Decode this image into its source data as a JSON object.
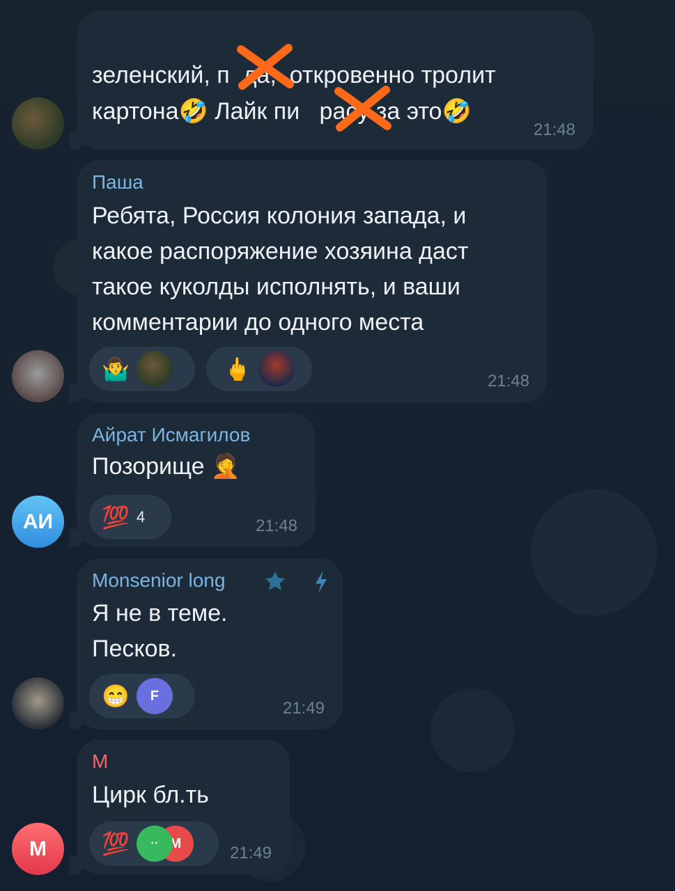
{
  "messages": [
    {
      "text_line1": "зеленский, п  да,  откровенно тролит",
      "text_line2": "картона🤣 Лайк пи   расу за это🤣",
      "time": "21:48"
    },
    {
      "sender": "Паша",
      "text": "Ребята, Россия колония запада, и\nкакое распоряжение хозяина даст\nтакое куколды исполнять, и ваши\nкомментарии до одного места",
      "reactions": [
        {
          "emoji": "🤷‍♂️"
        },
        {
          "emoji": "🖕"
        }
      ],
      "time": "21:48"
    },
    {
      "sender": "Айрат Исмагилов",
      "text": "Позорище 🤦",
      "avatar_initials": "АИ",
      "reactions": [
        {
          "emoji": "💯",
          "count": "4"
        }
      ],
      "time": "21:48"
    },
    {
      "sender": "Monsenior long",
      "text": "Я не в теме.\nПесков.",
      "reactions": [
        {
          "emoji": "😁",
          "reactor_initial": "F"
        }
      ],
      "time": "21:49"
    },
    {
      "sender": "М",
      "text": "Цирк бл.ть",
      "avatar_initials": "М",
      "reactions": [
        {
          "emoji": "💯",
          "reactor_initial": "М"
        }
      ],
      "time": "21:49"
    }
  ],
  "colors": {
    "background": "#162230",
    "bubble": "#1d2a38",
    "sender_blue": "#7bb6e3",
    "sender_red": "#f06b6b",
    "strike_orange": "#ff6a1a"
  }
}
